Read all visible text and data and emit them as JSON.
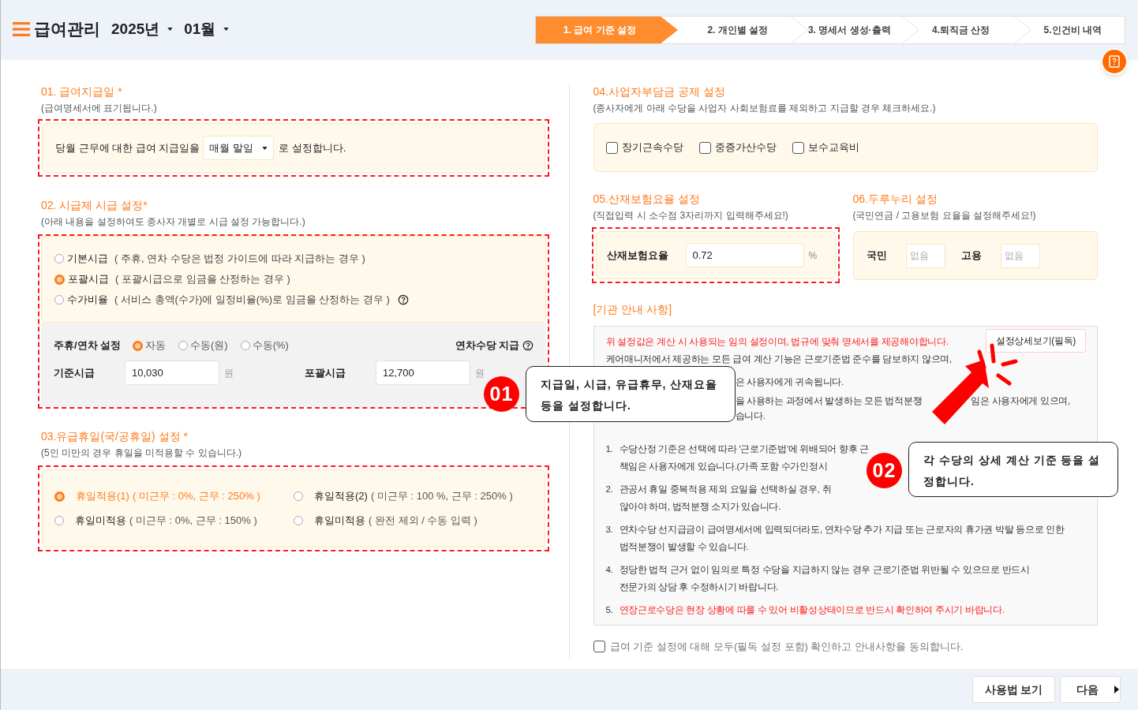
{
  "header": {
    "title": "급여관리",
    "year": "2025년",
    "month": "01월"
  },
  "steps": [
    {
      "label": "1. 급여 기준 설정",
      "selected": true
    },
    {
      "label": "2. 개인별 설정",
      "selected": false
    },
    {
      "label": "3. 명세서 생성·출력",
      "selected": false
    },
    {
      "label": "4.퇴직금 산정",
      "selected": false
    },
    {
      "label": "5.인건비 내역",
      "selected": false
    }
  ],
  "pay_day": {
    "title": "01. 급여지급일 *",
    "subtitle": "(급여명세서에 표기됩니다.)",
    "highlighted": true,
    "before": "당월 근무에 대한 급여 지급일을",
    "select": "매월 말일",
    "after": "로 설정합니다."
  },
  "hourly": {
    "title": "02. 시급제 시급 설정*",
    "subtitle": "(아래 내용을 설정하여도 종사자 개별로 시급 설정 가능합니다.)",
    "highlighted": true,
    "options": [
      {
        "label": "기본시급",
        "note": "( 주휴, 연차 수당은 법정 가이드에 따라 지급하는 경우 )",
        "selected": false,
        "help": false
      },
      {
        "label": "포괄시급",
        "note": "( 포괄시급으로 임금을 산정하는 경우 )",
        "selected": true,
        "help": false
      },
      {
        "label": "수가비율",
        "note": "( 서비스 총액(수가)에 일정비율(%)로 임금을 산정하는 경우 )",
        "selected": false,
        "help": true
      }
    ],
    "leave_label": "주휴/연차 설정",
    "leave_options": [
      {
        "label": "자동",
        "selected": true
      },
      {
        "label": "수동(원)",
        "selected": false
      },
      {
        "label": "수동(%)",
        "selected": false
      }
    ],
    "annual_pay": "연차수당 지급",
    "fields": [
      {
        "label": "기준시급",
        "value": "10,030",
        "unit": "원"
      },
      {
        "label": "포괄시급",
        "value": "12,700",
        "unit": "원"
      }
    ]
  },
  "holiday": {
    "title": "03.유급휴일(국/공휴일) 설정 *",
    "subtitle": "(5인 미만의 경우 휴일을 미적용할 수 있습니다.)",
    "highlighted": true,
    "options": [
      {
        "label": "휴일적용(1)",
        "note": "( 미근무 : 0%, 근무 : 250% )",
        "selected": true
      },
      {
        "label": "휴일적용(2)",
        "note": "( 미근무 : 100 %, 근무 : 250% )",
        "selected": false
      },
      {
        "label": "휴일미적용",
        "note": "( 미근무 : 0%, 근무 : 150% )",
        "selected": false
      },
      {
        "label": "휴일미적용",
        "note": "( 완전 제외 / 수동 입력 )",
        "selected": false
      }
    ]
  },
  "deduction": {
    "title": "04.사업자부담금 공제 설정",
    "subtitle": "(종사자에게 아래 수당을 사업자 사회보험료를 제외하고 지급할 경우 체크하세요.)",
    "items": [
      {
        "label": "장기근속수당",
        "checked": false
      },
      {
        "label": "중증가산수당",
        "checked": false
      },
      {
        "label": "보수교육비",
        "checked": false
      }
    ]
  },
  "accident": {
    "title": "05.산재보험요율 설정",
    "subtitle": "(직접입력 시 소수점 3자리까지 입력해주세요!)",
    "highlighted": true,
    "label": "산재보험요율",
    "value": "0.72",
    "unit": "%"
  },
  "durunuri": {
    "title": "06.두루누리 설정",
    "subtitle": "(국민연금 / 고용보험 요율을 설정해주세요!)",
    "fields": [
      {
        "label": "국민",
        "placeholder": "없음"
      },
      {
        "label": "고용",
        "placeholder": "없음"
      }
    ]
  },
  "notice": {
    "title": "[기관 안내 사항]",
    "warning": "위 설정값은 계산 시 사용되는 임의 설정이며, 법규에 맞춰 명세서를 제공해야합니다.",
    "detail_button": "설정상세보기(필독)",
    "intro": [
      [
        "케어매니저에서 제공하는 모든 급여 계산 기능은 근로기준법 준수를 담보하지 않으며,"
      ],
      [
        "은 사용자에게 귀속됩니다."
      ],
      [
        "을 사용하는 과정에서 발생하는 모든 법적분쟁",
        "임은 사용자에게 있으며,"
      ],
      [
        "습니다."
      ]
    ],
    "items": [
      {
        "number": "1.",
        "lines": [
          "수당산정 기준은 선택에 따라 '근로기준법'에 위배되어 향후 근",
          "책임은 사용자에게 있습니다.(가족 포함 수가인정시"
        ],
        "warning": false
      },
      {
        "number": "2.",
        "lines": [
          "관공서 휴일 중복적용 제외 요일을 선택하실 경우, 취",
          "않아야 하며, 법적분쟁 소지가 있습니다."
        ],
        "warning": false
      },
      {
        "number": "3.",
        "lines": [
          "연차수당 선지급금이 급여명세서에 입력되더라도, 연차수당 추가 지급 또는 근로자의 휴가권 박탈 등으로 인한",
          "법적분쟁이 발생할 수 있습니다."
        ],
        "warning": false
      },
      {
        "number": "4.",
        "lines": [
          "정당한 법적 근거 없이 임의로 특정 수당을 지급하지 않는 경우 근로기준법 위반될 수 있으므로 반드시",
          "전문가의 상담 후 수정하시기 바랍니다."
        ],
        "warning": false
      },
      {
        "number": "5.",
        "lines": [
          "연장근로수당은 현장 상황에 따를 수 있어 비활성상태이므로 반드시 확인하여 주시기 바랍니다."
        ],
        "warning": true
      }
    ]
  },
  "agree": {
    "label": "급여 기준 설정에 대해 모두(필독 설정 포함) 확인하고 안내사항을 동의합니다.",
    "checked": false
  },
  "callouts": [
    {
      "badge": "01",
      "text": "지급일, 시급, 유급휴무, 산재요율 등을 설정합니다."
    },
    {
      "badge": "02",
      "text": "각 수당의 상세 계산 기준 등을 설정합니다."
    }
  ],
  "footer": {
    "buttons": [
      "사용법 보기",
      "다음"
    ]
  }
}
